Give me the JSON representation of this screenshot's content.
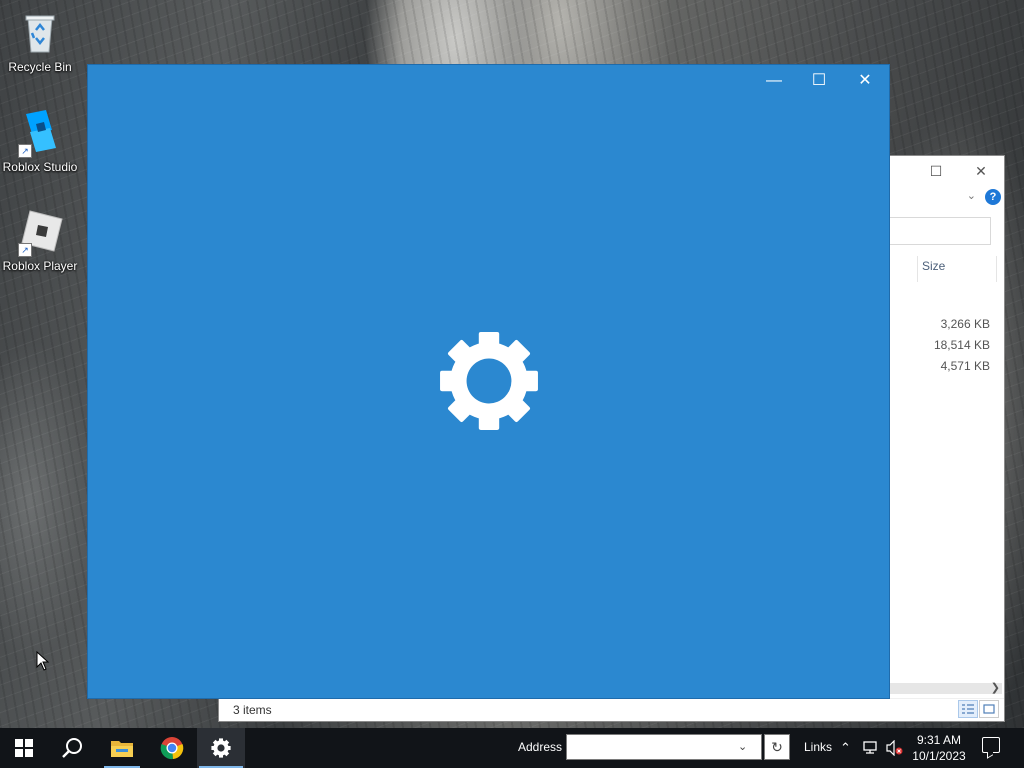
{
  "desktop": {
    "icons": [
      {
        "label": "Recycle Bin",
        "icon": "recycle-bin-icon"
      },
      {
        "label": "Roblox Studio",
        "icon": "roblox-studio-icon"
      },
      {
        "label": "Roblox Player",
        "icon": "roblox-player-icon"
      }
    ]
  },
  "explorer": {
    "column_header": "Size",
    "sizes": [
      "3,266 KB",
      "18,514 KB",
      "4,571 KB"
    ],
    "status_text": "3 items",
    "help_glyph": "?"
  },
  "settings_window": {
    "icon": "gear-icon",
    "background": "#2b88d0"
  },
  "taskbar": {
    "address_label": "Address",
    "address_value": "",
    "links_label": "Links",
    "clock_time": "9:31 AM",
    "clock_date": "10/1/2023",
    "pinned": [
      "windows-start-icon",
      "search-icon",
      "file-explorer-icon",
      "chrome-icon",
      "settings-icon"
    ]
  }
}
